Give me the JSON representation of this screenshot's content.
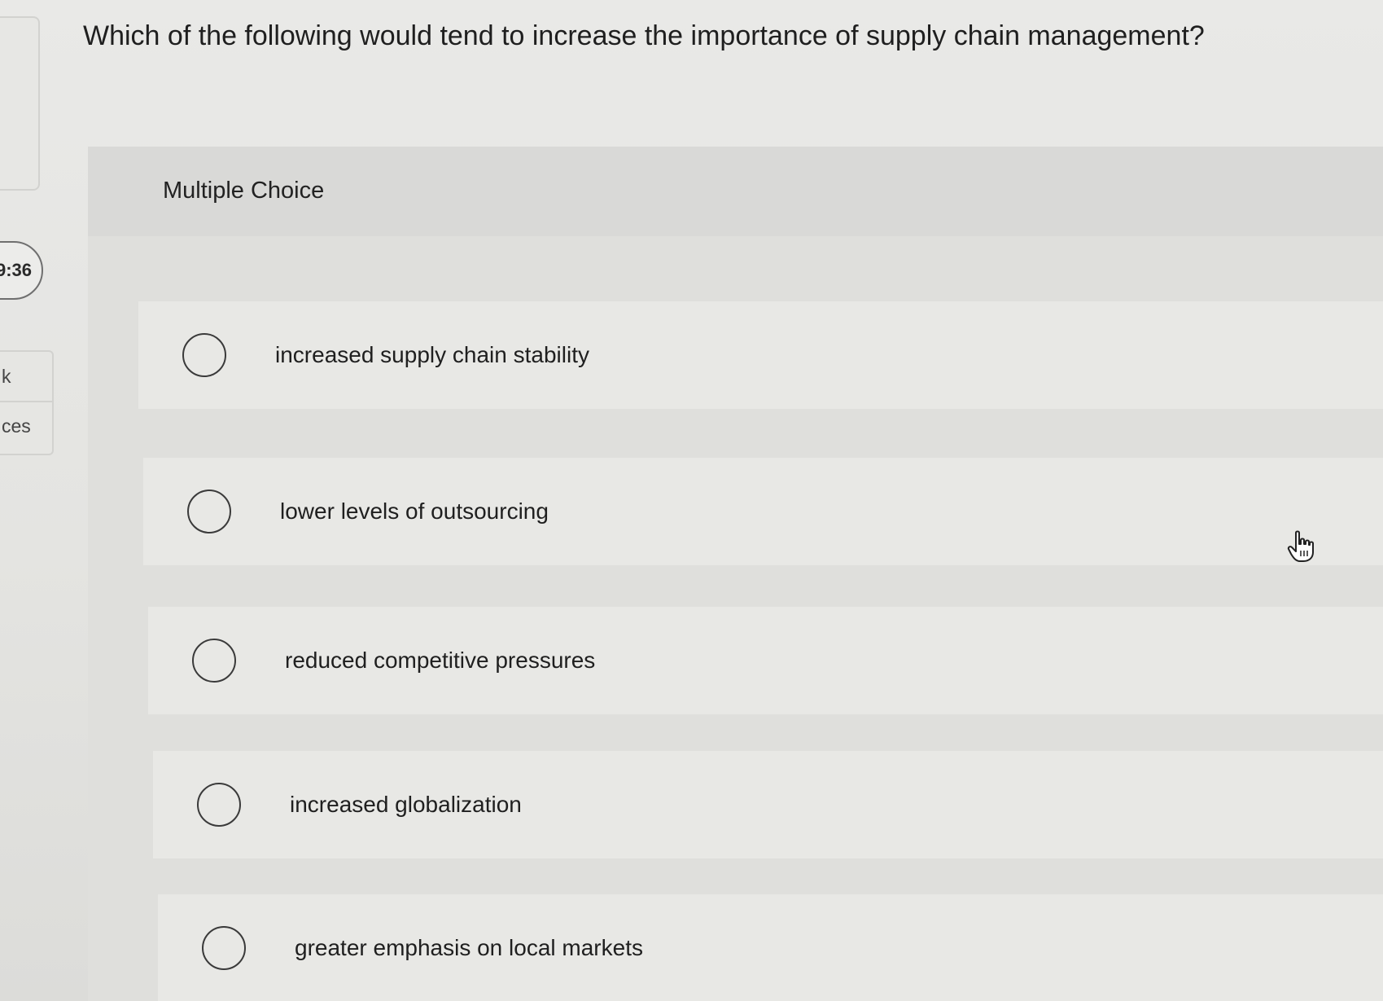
{
  "question": {
    "text": "Which of the following would tend to increase the importance of supply chain management?"
  },
  "sidebar": {
    "timer": "9:36",
    "tabs": [
      {
        "label": "k"
      },
      {
        "label": "ces"
      }
    ]
  },
  "multiple_choice": {
    "label": "Multiple Choice",
    "options": [
      {
        "label": "increased supply chain stability",
        "selected": false
      },
      {
        "label": "lower levels of outsourcing",
        "selected": false
      },
      {
        "label": "reduced competitive pressures",
        "selected": false
      },
      {
        "label": "increased globalization",
        "selected": false
      },
      {
        "label": "greater emphasis on local markets",
        "selected": false
      }
    ]
  },
  "icons": {
    "radio": "radio-unselected-icon",
    "cursor": "hand-pointer-icon"
  }
}
